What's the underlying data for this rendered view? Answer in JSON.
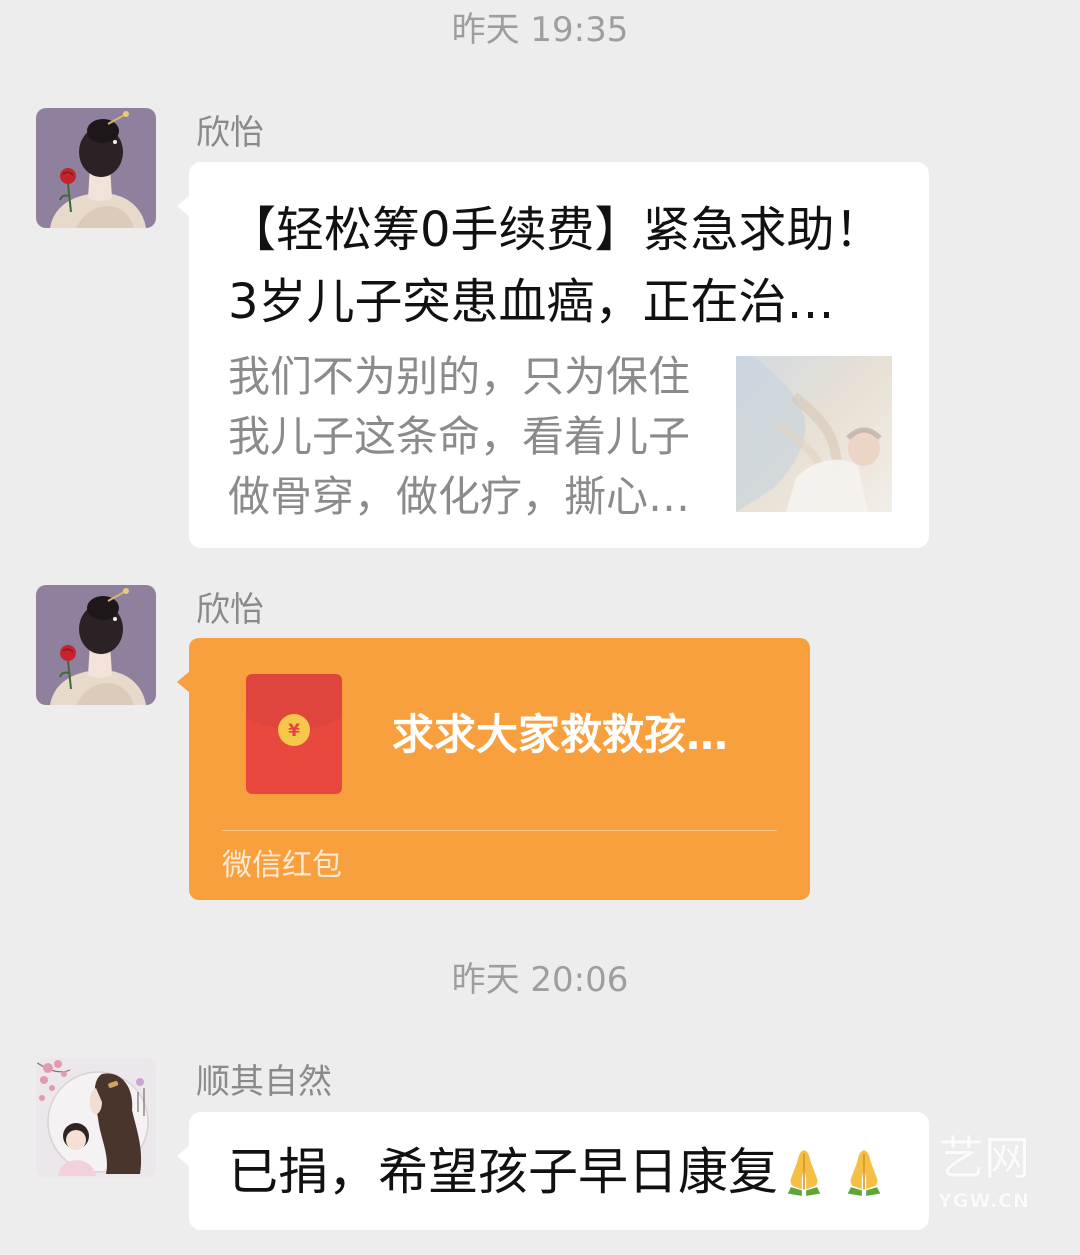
{
  "colors": {
    "background": "#EDEDED",
    "bubble": "#FFFFFF",
    "red_packet": "#F8A03E",
    "envelope": "#E9483F",
    "coin": "#F6C74A",
    "timestamp_text": "#9E9E9E",
    "sender_name_text": "#8A8A8A",
    "card_description_text": "#8B8B8B",
    "message_text": "#111111"
  },
  "timestamps": [
    "昨天 19:35",
    "昨天 20:06"
  ],
  "messages": [
    {
      "sender": "欣怡",
      "avatar_icon": "woman-with-rose-avatar",
      "title_lines": [
        "【轻松筹0手续费】紧急求助！",
        "3岁儿子突患血癌，正在治…"
      ],
      "description_lines": [
        "我们不为别的，只为保住",
        "我儿子这条命，看着儿子",
        "做骨穿，做化疗，撕心…"
      ],
      "thumbnail_icon": "child-in-treatment-thumbnail"
    },
    {
      "sender": "欣怡",
      "avatar_icon": "woman-with-rose-avatar",
      "red_packet": {
        "greeting": "求求大家救救孩…",
        "label": "微信红包",
        "icon": "red-envelope-icon",
        "coin_symbol": "¥"
      }
    },
    {
      "sender": "顺其自然",
      "avatar_icon": "mother-and-child-avatar",
      "text": "已捐，希望孩子早日康复",
      "emoji_icons": [
        "folded-hands-icon",
        "folded-hands-icon"
      ]
    }
  ],
  "watermark": {
    "logo_text": "艺网",
    "domain": "YGW.CN"
  }
}
